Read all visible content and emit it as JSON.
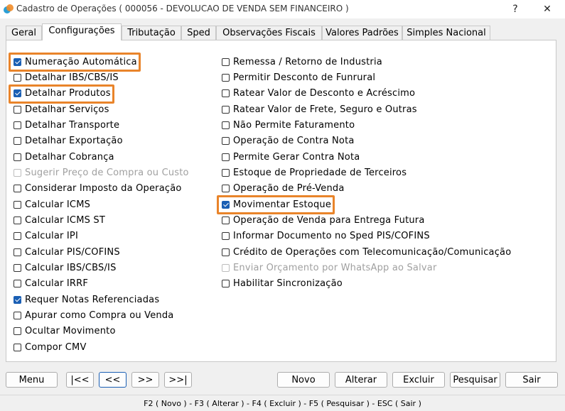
{
  "window": {
    "title": "Cadastro de Operações ( 000056 - DEVOLUCAO DE VENDA SEM FINANCEIRO )",
    "help_label": "?",
    "close_label": "✕"
  },
  "tabs": [
    {
      "label": "Geral"
    },
    {
      "label": "Configurações",
      "active": true
    },
    {
      "label": "Tributação"
    },
    {
      "label": "Sped"
    },
    {
      "label": "Observações Fiscais"
    },
    {
      "label": "Valores Padrões"
    },
    {
      "label": "Simples Nacional"
    }
  ],
  "left_options": [
    {
      "label": "Numeração Automática",
      "checked": true,
      "highlighted": true
    },
    {
      "label": "Detalhar IBS/CBS/IS",
      "checked": false
    },
    {
      "label": "Detalhar Produtos",
      "checked": true,
      "highlighted": true
    },
    {
      "label": "Detalhar Serviços",
      "checked": false
    },
    {
      "label": "Detalhar Transporte",
      "checked": false
    },
    {
      "label": "Detalhar Exportação",
      "checked": false
    },
    {
      "label": "Detalhar Cobrança",
      "checked": false
    },
    {
      "label": "Sugerir Preço de Compra ou Custo",
      "checked": false,
      "disabled": true
    },
    {
      "label": "Considerar Imposto da Operação",
      "checked": false
    },
    {
      "label": "Calcular ICMS",
      "checked": false
    },
    {
      "label": "Calcular ICMS ST",
      "checked": false
    },
    {
      "label": "Calcular IPI",
      "checked": false
    },
    {
      "label": "Calcular PIS/COFINS",
      "checked": false
    },
    {
      "label": "Calcular IBS/CBS/IS",
      "checked": false
    },
    {
      "label": "Calcular IRRF",
      "checked": false
    },
    {
      "label": "Requer Notas Referenciadas",
      "checked": true
    },
    {
      "label": "Apurar como Compra ou Venda",
      "checked": false
    },
    {
      "label": "Ocultar Movimento",
      "checked": false
    },
    {
      "label": "Compor CMV",
      "checked": false
    }
  ],
  "right_options": [
    {
      "label": "Remessa / Retorno de Industria",
      "checked": false
    },
    {
      "label": "Permitir Desconto de Funrural",
      "checked": false
    },
    {
      "label": "Ratear Valor de Desconto e Acréscimo",
      "checked": false
    },
    {
      "label": "Ratear Valor de Frete, Seguro e Outras",
      "checked": false
    },
    {
      "label": "Não Permite Faturamento",
      "checked": false
    },
    {
      "label": "Operação de Contra Nota",
      "checked": false
    },
    {
      "label": "Permite Gerar Contra Nota",
      "checked": false
    },
    {
      "label": "Estoque de Propriedade de Terceiros",
      "checked": false
    },
    {
      "label": "Operação de Pré-Venda",
      "checked": false
    },
    {
      "label": "Movimentar Estoque",
      "checked": true,
      "highlighted": true
    },
    {
      "label": "Operação de Venda para Entrega Futura",
      "checked": false
    },
    {
      "label": "Informar Documento no Sped PIS/COFINS",
      "checked": false
    },
    {
      "label": "Crédito de Operações com Telecomunicação/Comunicação",
      "checked": false
    },
    {
      "label": "Enviar Orçamento por WhatsApp ao Salvar",
      "checked": false,
      "disabled": true
    },
    {
      "label": "Habilitar Sincronização",
      "checked": false
    }
  ],
  "buttons": {
    "menu": "Menu",
    "first": "|<<",
    "prev": "<<",
    "next": ">>",
    "last": ">>|",
    "novo": "Novo",
    "alterar": "Alterar",
    "excluir": "Excluir",
    "pesquisar": "Pesquisar",
    "sair": "Sair"
  },
  "status_bar": "F2 ( Novo )  -  F3 ( Alterar )  -  F4 ( Excluir )  -  F5 ( Pesquisar )  -  ESC ( Sair )",
  "colors": {
    "highlight": "#e9842a",
    "check_fill": "#1a5fb4"
  }
}
